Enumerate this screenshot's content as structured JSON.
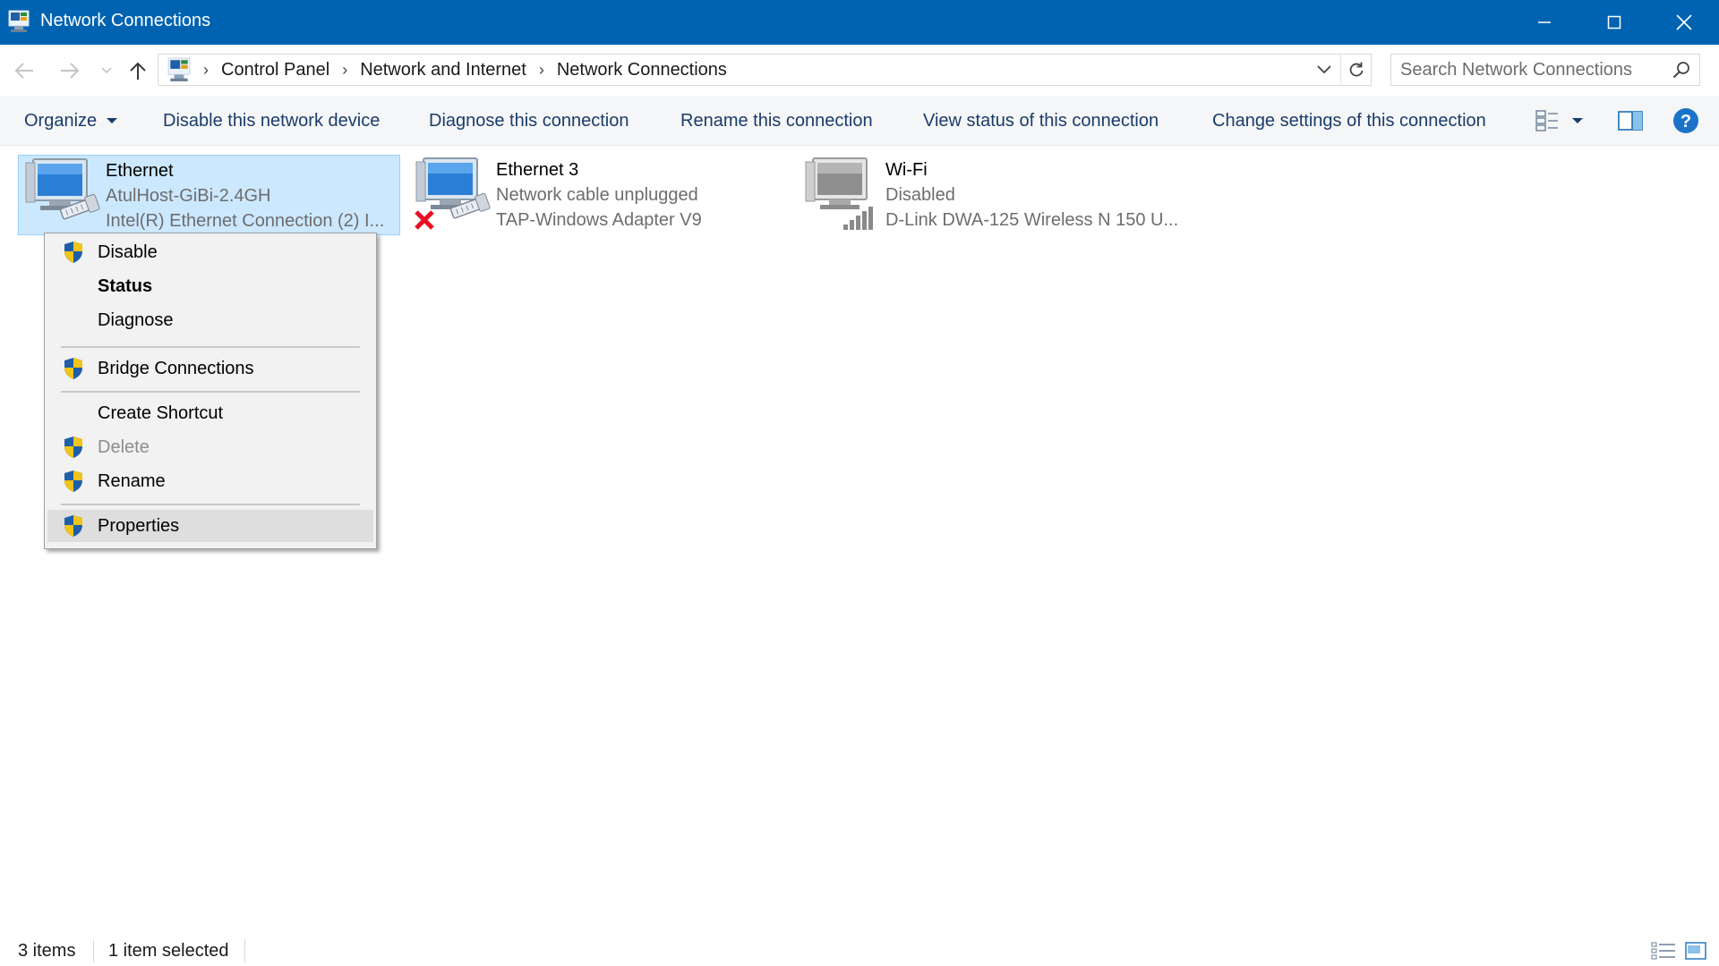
{
  "window": {
    "title": "Network Connections"
  },
  "address": {
    "crumbs": [
      "Control Panel",
      "Network and Internet",
      "Network Connections"
    ],
    "search_placeholder": "Search Network Connections"
  },
  "toolbar": {
    "organize": "Organize",
    "disable": "Disable this network device",
    "diagnose": "Diagnose this connection",
    "rename": "Rename this connection",
    "view_status": "View status of this connection",
    "change_settings": "Change settings of this connection"
  },
  "connections": [
    {
      "name": "Ethernet",
      "status": "AtulHost-GiBi-2.4GH",
      "device": "Intel(R) Ethernet Connection (2) I..."
    },
    {
      "name": "Ethernet 3",
      "status": "Network cable unplugged",
      "device": "TAP-Windows Adapter V9"
    },
    {
      "name": "Wi-Fi",
      "status": "Disabled",
      "device": "D-Link DWA-125 Wireless N 150 U..."
    }
  ],
  "context_menu": {
    "items": [
      {
        "label": "Disable"
      },
      {
        "label": "Status"
      },
      {
        "label": "Diagnose"
      },
      {
        "label": "Bridge Connections"
      },
      {
        "label": "Create Shortcut"
      },
      {
        "label": "Delete"
      },
      {
        "label": "Rename"
      },
      {
        "label": "Properties"
      }
    ]
  },
  "statusbar": {
    "item_count": "3 items",
    "selection": "1 item selected"
  },
  "colors": {
    "titlebar": "#0063b1",
    "selection_fill": "#cce8ff",
    "selection_border": "#99d1ff",
    "menu_bg": "#f2f2f2",
    "toolbar_text": "#1a3c6b",
    "subtext": "#6d6d6d"
  },
  "icons": [
    "network-connections-icon",
    "back-arrow-icon",
    "forward-arrow-icon",
    "recent-dropdown-icon",
    "up-arrow-icon",
    "control-panel-icon",
    "chevron-down-icon",
    "refresh-icon",
    "search-icon",
    "organize-dropdown-icon",
    "change-view-icon",
    "preview-pane-icon",
    "help-icon",
    "network-adapter-icon",
    "unplugged-x-icon",
    "signal-bars-icon",
    "uac-shield-icon",
    "details-view-icon",
    "large-icons-view-icon"
  ]
}
